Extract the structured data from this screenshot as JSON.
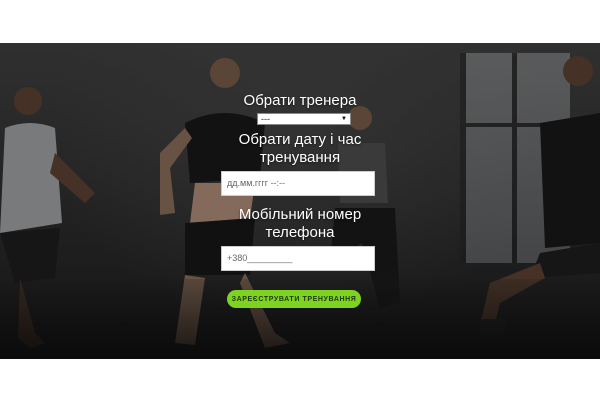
{
  "form": {
    "trainer_label": "Обрати тренера",
    "trainer_select_value": "---",
    "datetime_label": "Обрати дату і час тренування",
    "datetime_value": "дд.мм.гггг --:--",
    "phone_label": "Мобільний номер телефона",
    "phone_value": "+380_________",
    "submit_label": "ЗАРЕЄСТРУВАТИ ТРЕНУВАННЯ"
  },
  "colors": {
    "accent": "#7ed321",
    "input_bg": "#ffffff",
    "label_text": "#ffffff"
  },
  "icons": {
    "select_arrow": "chevron-down-icon"
  }
}
